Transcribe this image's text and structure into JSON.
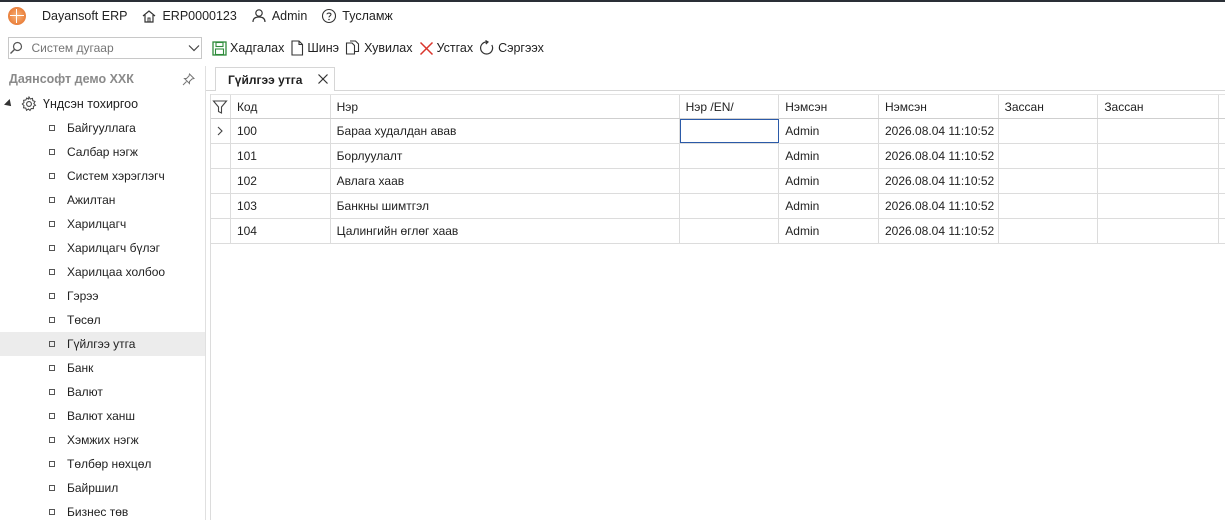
{
  "titlebar": {
    "app_name": "Dayansoft ERP",
    "home_label": "ERP0000123",
    "user_label": "Admin",
    "help_label": "Тусламж"
  },
  "search": {
    "placeholder": "Систем дугаар"
  },
  "toolbar": {
    "save_label": "Хадгалах",
    "new_label": "Шинэ",
    "copy_label": "Хувилах",
    "delete_label": "Устгах",
    "refresh_label": "Сэргээх"
  },
  "sidebar": {
    "company": "Даянсофт демо ХХК",
    "root_label": "Үндсэн тохиргоо",
    "items": [
      {
        "label": "Байгууллага"
      },
      {
        "label": "Салбар нэгж"
      },
      {
        "label": "Систем хэрэглэгч"
      },
      {
        "label": "Ажилтан"
      },
      {
        "label": "Харилцагч"
      },
      {
        "label": "Харилцагч бүлэг"
      },
      {
        "label": "Харилцаа холбоо"
      },
      {
        "label": "Гэрээ"
      },
      {
        "label": "Төсөл"
      },
      {
        "label": "Гүйлгээ утга"
      },
      {
        "label": "Банк"
      },
      {
        "label": "Валют"
      },
      {
        "label": "Валют ханш"
      },
      {
        "label": "Хэмжих нэгж"
      },
      {
        "label": "Төлбөр нөхцөл"
      },
      {
        "label": "Байршил"
      },
      {
        "label": "Бизнес төв"
      }
    ],
    "selected_index": 9
  },
  "tab": {
    "label": "Гүйлгээ утга"
  },
  "grid": {
    "columns": [
      "Код",
      "Нэр",
      "Нэр /EN/",
      "Нэмсэн",
      "Нэмсэн",
      "Зассан",
      "Зассан"
    ],
    "rows": [
      {
        "code": "100",
        "name": "Бараа худалдан авав",
        "name_en": "",
        "created_by": "Admin",
        "created_at": "2026.08.04 11:10:52",
        "modified_by": "",
        "modified_at": ""
      },
      {
        "code": "101",
        "name": "Борлуулалт",
        "name_en": "",
        "created_by": "Admin",
        "created_at": "2026.08.04 11:10:52",
        "modified_by": "",
        "modified_at": ""
      },
      {
        "code": "102",
        "name": "Авлага хаав",
        "name_en": "",
        "created_by": "Admin",
        "created_at": "2026.08.04 11:10:52",
        "modified_by": "",
        "modified_at": ""
      },
      {
        "code": "103",
        "name": "Банкны шимтгэл",
        "name_en": "",
        "created_by": "Admin",
        "created_at": "2026.08.04 11:10:52",
        "modified_by": "",
        "modified_at": ""
      },
      {
        "code": "104",
        "name": "Цалингийн өглөг хаав",
        "name_en": "",
        "created_by": "Admin",
        "created_at": "2026.08.04 11:10:52",
        "modified_by": "",
        "modified_at": ""
      }
    ]
  },
  "colors": {
    "accent": "#2b5aa8",
    "save_icon": "#2e8b3a",
    "delete_icon": "#d9342b"
  }
}
